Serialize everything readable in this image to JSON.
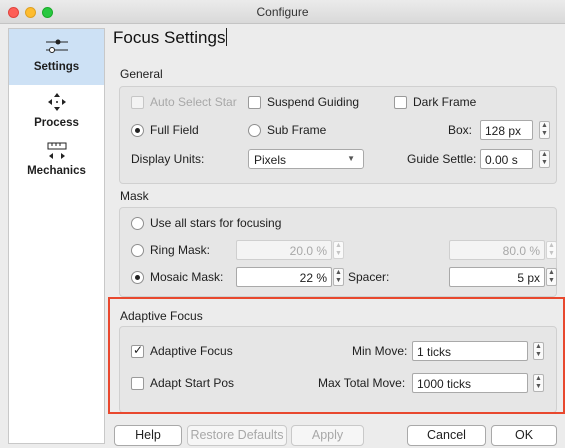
{
  "window": {
    "title": "Configure"
  },
  "sidebar": {
    "items": [
      {
        "label": "Settings",
        "icon": "sliders-icon",
        "active": true
      },
      {
        "label": "Process",
        "icon": "move-arrows-icon",
        "active": false
      },
      {
        "label": "Mechanics",
        "icon": "ruler-icon",
        "active": false
      }
    ]
  },
  "page": {
    "title": "Focus Settings"
  },
  "general": {
    "title": "General",
    "auto_select_star": "Auto Select Star",
    "suspend_guiding": "Suspend Guiding",
    "dark_frame": "Dark Frame",
    "full_field": "Full Field",
    "sub_frame": "Sub Frame",
    "box_label": "Box:",
    "box_value": "128 px",
    "display_units_label": "Display Units:",
    "display_units_value": "Pixels",
    "guide_settle_label": "Guide Settle:",
    "guide_settle_value": "0.00 s"
  },
  "mask": {
    "title": "Mask",
    "use_all_stars": "Use all stars for focusing",
    "ring_mask": "Ring Mask:",
    "ring_inner": "20.0 %",
    "ring_outer": "80.0 %",
    "mosaic_mask": "Mosaic Mask:",
    "mosaic_value": "22 %",
    "spacer_label": "Spacer:",
    "spacer_value": "5 px"
  },
  "adaptive": {
    "title": "Adaptive Focus",
    "adaptive_focus": "Adaptive Focus",
    "adaptive_focus_checked": true,
    "adapt_start_pos": "Adapt Start Pos",
    "adapt_start_pos_checked": false,
    "min_move_label": "Min Move:",
    "min_move_value": "1 ticks",
    "max_total_move_label": "Max Total Move:",
    "max_total_move_value": "1000 ticks"
  },
  "footer": {
    "help": "Help",
    "restore_defaults": "Restore Defaults",
    "apply": "Apply",
    "cancel": "Cancel",
    "ok": "OK"
  }
}
